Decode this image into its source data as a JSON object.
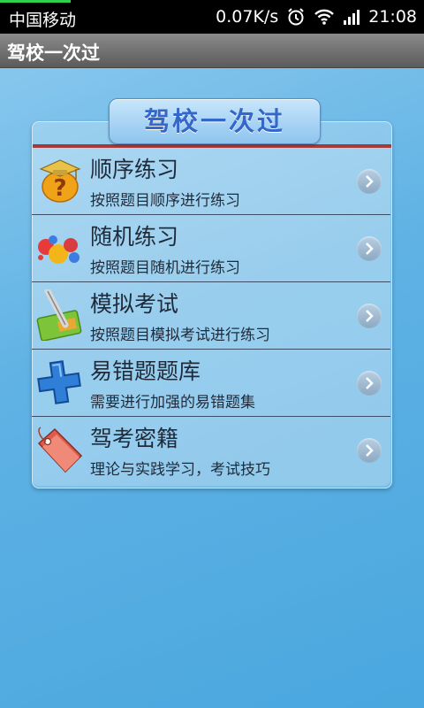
{
  "status_bar": {
    "carrier": "中国移动",
    "speed": "0.07K/s",
    "time": "21:08"
  },
  "title_bar": {
    "title": "驾校一次过"
  },
  "card": {
    "header": "驾校一次过"
  },
  "menu": [
    {
      "title": "顺序练习",
      "subtitle": "按照题目顺序进行练习",
      "icon": "question-cap-icon"
    },
    {
      "title": "随机练习",
      "subtitle": "按照题目随机进行练习",
      "icon": "random-blobs-icon"
    },
    {
      "title": "模拟考试",
      "subtitle": "按照题目模拟考试进行练习",
      "icon": "exam-pen-icon"
    },
    {
      "title": "易错题题库",
      "subtitle": "需要进行加强的易错题集",
      "icon": "plus-cross-icon"
    },
    {
      "title": "驾考密籍",
      "subtitle": "理论与实践学习，考试技巧",
      "icon": "tag-icon"
    }
  ]
}
